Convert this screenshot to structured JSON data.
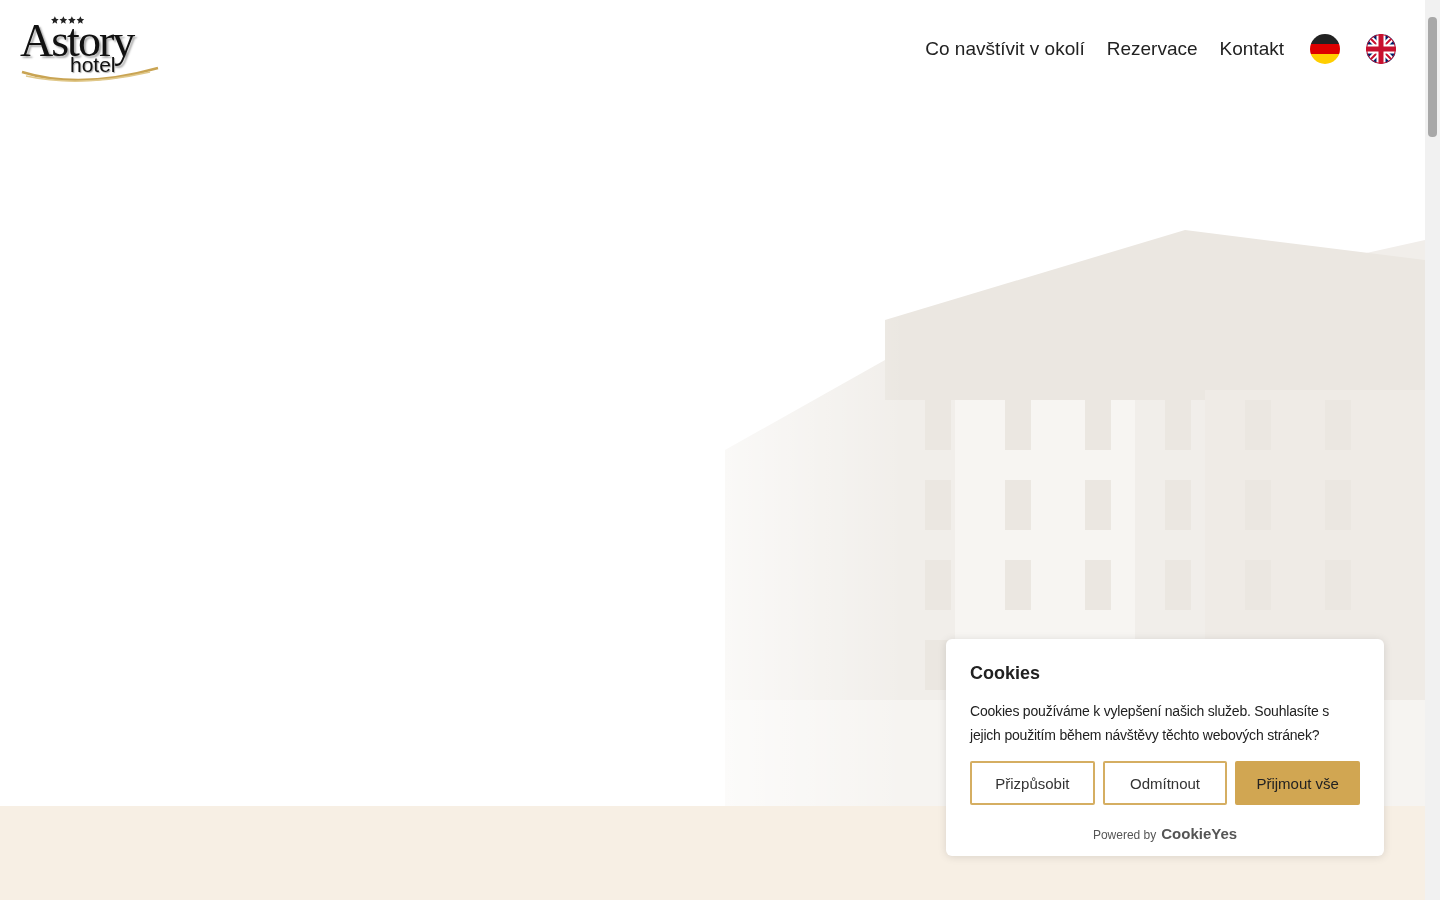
{
  "logo": {
    "name": "Astory",
    "sub": "hotel"
  },
  "nav": [
    "Co navštívit v okolí",
    "Rezervace",
    "Kontakt"
  ],
  "languages": [
    {
      "kind": "de"
    },
    {
      "kind": "en"
    }
  ],
  "cookie_banner": {
    "title": "Cookies",
    "text": "Cookies používáme k vylepšení našich služeb. Souhlasíte s jejich použitím během návštěvy těchto webových stránek?",
    "buttons": [
      {
        "label": "Přizpůsobit",
        "kind": "outline"
      },
      {
        "label": "Odmítnout",
        "kind": "outline"
      },
      {
        "label": "Přijmout vše",
        "kind": "primary"
      }
    ],
    "powered_by": "Powered by",
    "brand": "CookieYes"
  }
}
